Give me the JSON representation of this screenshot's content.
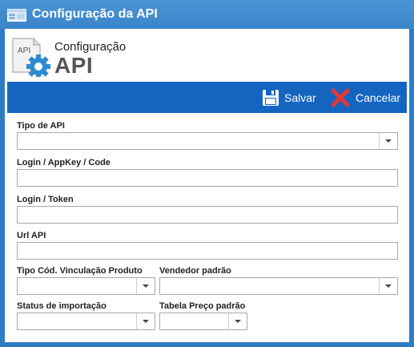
{
  "window": {
    "title": "Configuração da API"
  },
  "header": {
    "subtitle": "Configuração",
    "title": "API",
    "icon_label": "API"
  },
  "toolbar": {
    "save_label": "Salvar",
    "cancel_label": "Cancelar"
  },
  "form": {
    "tipo_api": {
      "label": "Tipo de API",
      "value": ""
    },
    "login_appkey": {
      "label": "Login / AppKey / Code",
      "value": ""
    },
    "login_token": {
      "label": "Login / Token",
      "value": ""
    },
    "url_api": {
      "label": "Url API",
      "value": ""
    },
    "tipo_cod": {
      "label": "Tipo Cód. Vinculação Produto",
      "value": ""
    },
    "vendedor": {
      "label": "Vendedor padrão",
      "value": ""
    },
    "status_importacao": {
      "label": "Status de importação",
      "value": ""
    },
    "tabela_preco": {
      "label": "Tabela Preço padrão",
      "value": ""
    }
  },
  "colors": {
    "titlebar": "#3a84c8",
    "toolbar": "#1565c0",
    "cancel_icon": "#e53935"
  }
}
